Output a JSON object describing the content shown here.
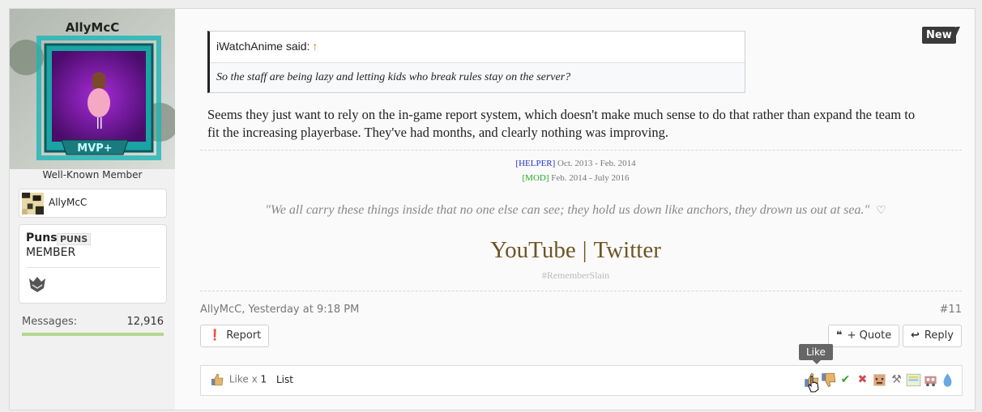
{
  "sidebar": {
    "username": "AllyMcC",
    "user_title": "Well-Known Member",
    "ign": "AllyMcC",
    "rank": {
      "name": "Puns",
      "tag": "PUNS",
      "title": "MEMBER"
    },
    "messages_label": "Messages:",
    "messages_value": "12,916",
    "messages_progress": 1.0,
    "avatar_badge": "MVP+"
  },
  "post": {
    "new_badge": "New",
    "quote": {
      "author": "iWatchAnime said:",
      "arrow": "↑",
      "text": "So the staff are being lazy and letting kids who break rules stay on the server?"
    },
    "body": "Seems they just want to rely on the in-game report system, which doesn't make much sense to do that rather than expand the team to fit the increasing playerbase. They've had months, and clearly nothing was improving.",
    "signature": {
      "helper_role": "[HELPER]",
      "helper_dates": "Oct. 2013 - Feb. 2014",
      "mod_role": "[MOD]",
      "mod_dates": "Feb. 2014 - July 2016",
      "quote": "\"We all carry these things inside that no one else can see; they hold us down like anchors, they drown us out at sea.\"",
      "link_youtube": "YouTube",
      "link_separator": "|",
      "link_twitter": "Twitter",
      "hashtag": "#RememberSlain"
    },
    "meta": {
      "author_time": "AllyMcC, Yesterday at 9:18 PM",
      "post_number": "#11"
    },
    "buttons": {
      "report": "Report",
      "quote": "+ Quote",
      "reply": "Reply"
    },
    "tooltip": "Like",
    "ratings": {
      "like_label": "Like x",
      "like_count": "1",
      "list_label": "List",
      "icons": [
        "like-icon",
        "dislike-icon",
        "agree-icon",
        "disagree-icon",
        "funny-icon",
        "tools-icon",
        "rainbow-icon",
        "train-icon",
        "water-drop-icon"
      ]
    }
  },
  "colors": {
    "helper": "#2233cc",
    "mod": "#22aa22",
    "signature_links": "#6e5525",
    "progress": "#b5d68f"
  }
}
